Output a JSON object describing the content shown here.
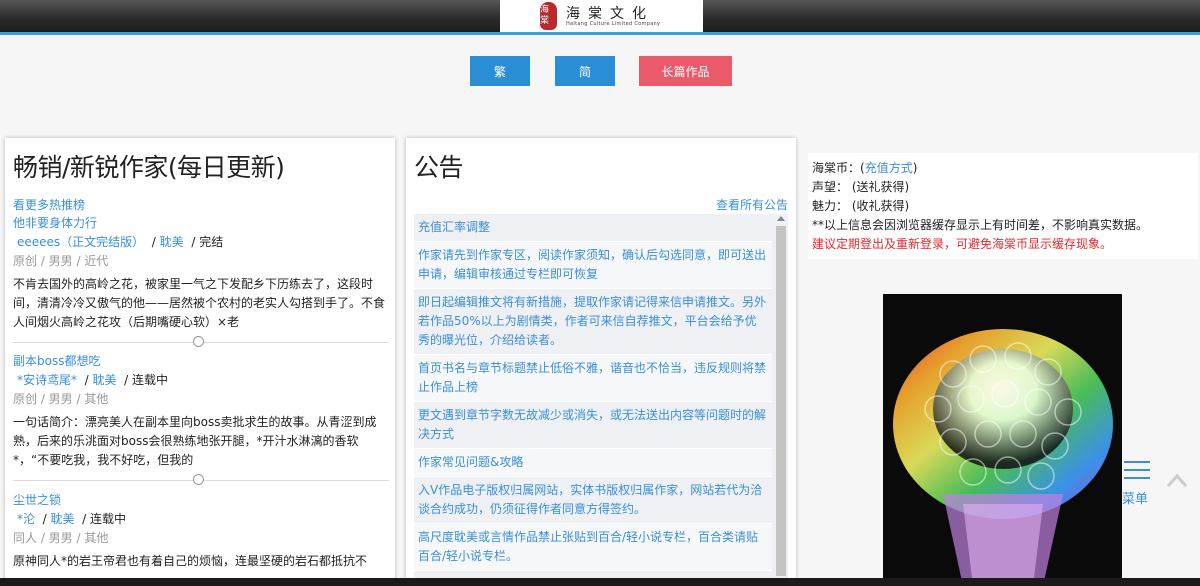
{
  "header": {
    "seal_text": "海棠",
    "title": "海棠文化",
    "subtitle": "Haitang Culture Limited Company"
  },
  "buttons": {
    "traditional": "繁",
    "simplified": "简",
    "long_works": "长篇作品"
  },
  "bestsellers": {
    "title": "畅销/新锐作家(每日更新)",
    "more_link": "看更多热推榜",
    "books": [
      {
        "title": "他非要身体力行",
        "author": "eeeees（正文完结版）",
        "genre": "耽美",
        "status": "完结",
        "category": "原创 / 男男 / 近代",
        "description": "不肯去国外的高岭之花，被家里一气之下发配乡下历练去了，这段时间，清清冷冷又傲气的他——居然被个农村的老实人勾搭到手了。不食人间烟火高岭之花攻（后期嘴硬心软）×老"
      },
      {
        "title": "副本boss都想吃",
        "author": "*安诗鸢尾*",
        "genre": "耽美",
        "status": "连载中",
        "category": "原创 / 男男 / 其他",
        "description": "一句话简介：漂亮美人在副本里向boss卖批求生的故事。从青涩到成熟，后来的乐洮面对boss会很熟练地张开腿，*开汁水淋漓的香软*，“不要吃我，我不好吃，但我的"
      },
      {
        "title": "尘世之锁",
        "author": "*沦",
        "genre": "耽美",
        "status": "连载中",
        "category": "同人 / 男男 / 其他",
        "description": "原神同人*的岩王帝君也有着自己的烦恼，连最坚硬的岩石都抵抗不"
      }
    ]
  },
  "notices": {
    "title": "公告",
    "all_link": "查看所有公告",
    "items": [
      "充值汇率调整",
      "作家请先到作家专区，阅读作家须知，确认后勾选同意，即可送出申请，编辑审核通过专栏即可恢复",
      "即日起编辑推文将有新措施，提取作家请记得来信申请推文。另外若作品50%以上为剧情类，作者可来信自荐推文，平台会给予优秀的曝光位，介绍给读者。",
      "首页书名与章节标题禁止低俗不雅，谐音也不恰当，违反规则将禁止作品上榜",
      "更文遇到章节字数无故减少或消失，或无法送出内容等问题时的解决方式",
      "作家常见问题&攻略",
      "入V作品电子版权归属网站，实体书版权归属作家，网站若代为洽谈合约成功，仍须征得作者同意方得签约。",
      "高尺度耽美或言情作品禁止张贴到百合/轻小说专栏，百合类请贴百合/轻小说专栏。"
    ]
  },
  "account": {
    "coins_label": "海棠币：",
    "coins_link": "充值方式",
    "fame_label": "声望：",
    "fame_value": "(送礼获得)",
    "charm_label": "魅力：",
    "charm_value": "(收礼获得)",
    "note": "**以上信息会因浏览器缓存显示上有时间差，不影响真实数据。",
    "warning": "建议定期登出及重新登录，可避免海棠币显示缓存现象。"
  },
  "side": {
    "menu_label": "菜单"
  },
  "colors": {
    "accent_blue": "#2a8ed6",
    "link_blue": "#3a8fd6",
    "button_pink": "#ea5a6a",
    "warning_red": "#e8282c"
  }
}
